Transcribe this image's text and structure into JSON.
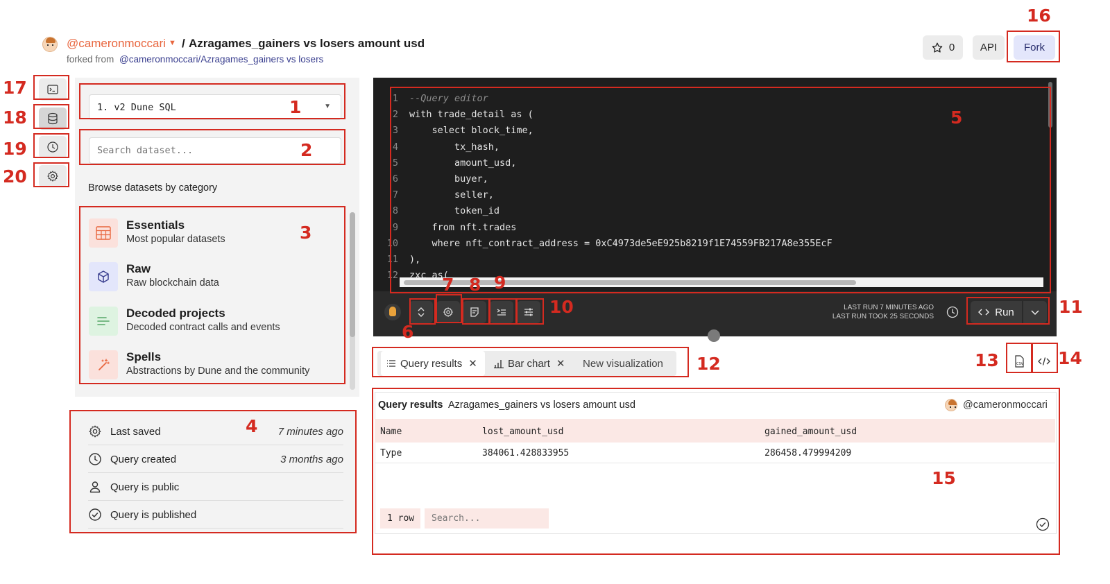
{
  "header": {
    "username": "@cameronmoccari",
    "separator": "/",
    "query_title": "Azragames_gainers vs losers amount usd",
    "forked_prefix": "forked from",
    "forked_link": "@cameronmoccari/Azragames_gainers vs losers",
    "star_count": "0",
    "api_label": "API",
    "fork_label": "Fork"
  },
  "dataset_panel": {
    "engine_value": "1. v2 Dune SQL",
    "search_placeholder": "Search dataset...",
    "browse_heading": "Browse datasets by category",
    "categories": [
      {
        "title": "Essentials",
        "subtitle": "Most popular datasets",
        "icon": "table-icon"
      },
      {
        "title": "Raw",
        "subtitle": "Raw blockchain data",
        "icon": "cube-icon"
      },
      {
        "title": "Decoded projects",
        "subtitle": "Decoded contract calls and events",
        "icon": "lines-icon"
      },
      {
        "title": "Spells",
        "subtitle": "Abstractions by Dune and the community",
        "icon": "wand-icon"
      }
    ]
  },
  "info": {
    "rows": [
      {
        "label": "Last saved",
        "value": "7 minutes ago",
        "icon": "gear-icon"
      },
      {
        "label": "Query created",
        "value": "3 months ago",
        "icon": "clock-icon"
      },
      {
        "label": "Query is public",
        "value": "",
        "icon": "person-icon"
      },
      {
        "label": "Query is published",
        "value": "",
        "icon": "check-circle-icon"
      }
    ]
  },
  "editor": {
    "lines": [
      {
        "n": "1",
        "text": "--Query editor"
      },
      {
        "n": "2",
        "text": "with trade_detail as ("
      },
      {
        "n": "3",
        "text": "    select block_time,"
      },
      {
        "n": "4",
        "text": "        tx_hash,"
      },
      {
        "n": "5",
        "text": "        amount_usd,"
      },
      {
        "n": "6",
        "text": "        buyer,"
      },
      {
        "n": "7",
        "text": "        seller,"
      },
      {
        "n": "8",
        "text": "        token_id"
      },
      {
        "n": "9",
        "text": "    from nft.trades"
      },
      {
        "n": "10",
        "text": "    where nft_contract_address = 0xC4973de5eE925b8219f1E74559FB217A8e355EcF"
      },
      {
        "n": "11",
        "text": "),"
      },
      {
        "n": "12",
        "text": "zxc as("
      }
    ],
    "last_run": "LAST RUN 7 MINUTES AGO",
    "last_run_took": "LAST RUN TOOK 25 SECONDS",
    "run_label": "Run"
  },
  "tabs": [
    {
      "label": "Query results",
      "closable": true
    },
    {
      "label": "Bar chart",
      "closable": true
    },
    {
      "label": "New visualization",
      "closable": false
    }
  ],
  "results": {
    "label": "Query results",
    "title": "Azragames_gainers vs losers amount usd",
    "owner": "@cameronmoccari",
    "columns": [
      "Name",
      "lost_amount_usd",
      "gained_amount_usd"
    ],
    "rows": [
      [
        "Type",
        "384061.428833955",
        "286458.479994209"
      ]
    ],
    "row_count": "1 row",
    "search_placeholder": "Search..."
  },
  "callouts": [
    "1",
    "2",
    "3",
    "4",
    "5",
    "6",
    "7",
    "8",
    "9",
    "10",
    "11",
    "12",
    "13",
    "14",
    "15",
    "16",
    "17",
    "18",
    "19",
    "20"
  ],
  "colors": {
    "annotation_red": "#d42a20",
    "fork_bg": "#e3e6fb",
    "editor_bg": "#1e1e1e",
    "results_header_bg": "#fbe8e5"
  }
}
